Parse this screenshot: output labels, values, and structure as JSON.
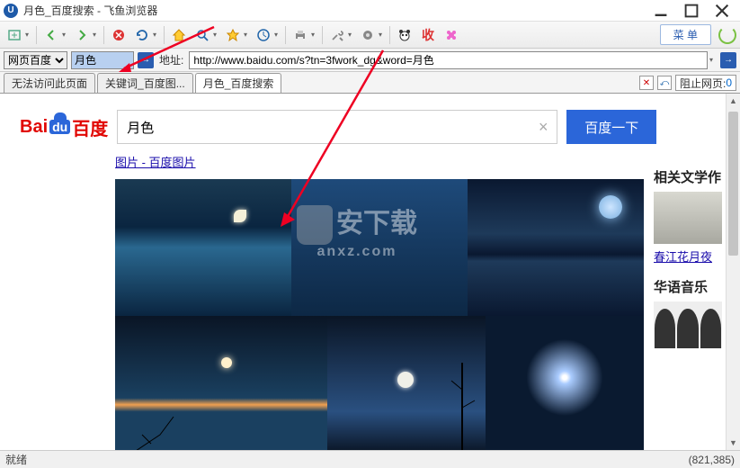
{
  "window": {
    "title": "月色_百度搜索 - 飞鱼浏览器",
    "menu_label": "菜 单"
  },
  "addrbar": {
    "search_engine": "网页百度",
    "mini_search_value": "月色",
    "addr_label": "地址:",
    "url": "http://www.baidu.com/s?tn=3fwork_dg&word=月色"
  },
  "tabs": [
    {
      "label": "无法访问此页面"
    },
    {
      "label": "关键词_百度图..."
    },
    {
      "label": "月色_百度搜索"
    }
  ],
  "tab_controls": {
    "block_label": "阻止网页:",
    "block_count": "0"
  },
  "baidu": {
    "search_value": "月色",
    "search_btn": "百度一下",
    "breadcrumb": "图片 - 百度图片"
  },
  "sidebar": {
    "sec1_title": "相关文学作",
    "sec1_link": "春江花月夜",
    "sec2_title": "华语音乐"
  },
  "watermark": {
    "main": "安下载",
    "sub": "anxz.com"
  },
  "status": {
    "ready": "就绪",
    "coords": "(821,385)"
  }
}
